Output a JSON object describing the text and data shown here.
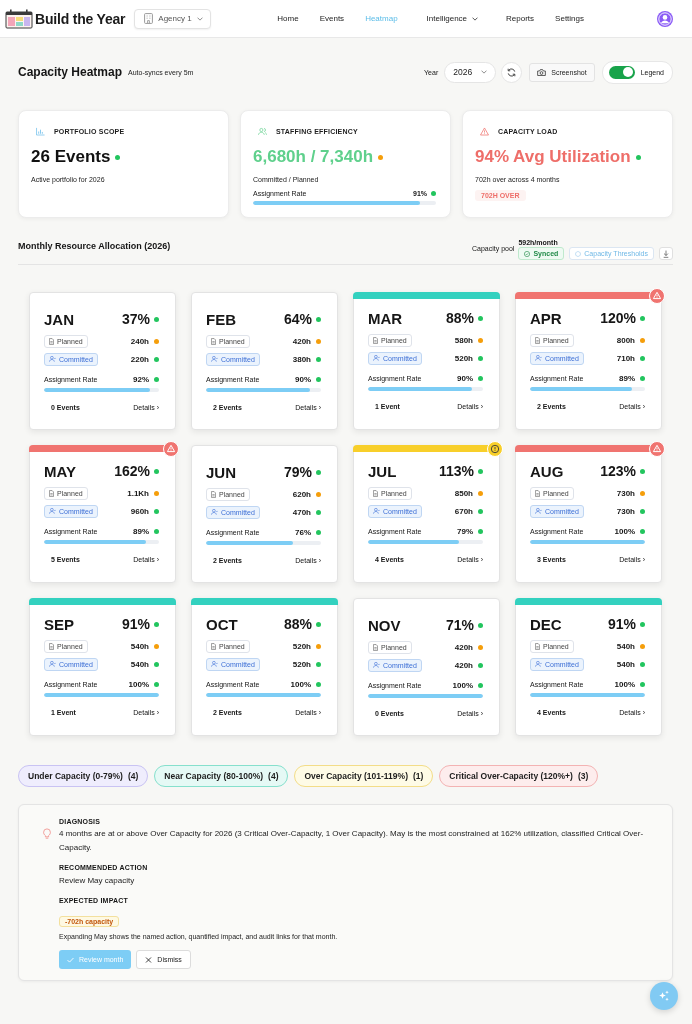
{
  "header": {
    "brand": "Build the Year",
    "agency": "Agency 1",
    "nav": [
      {
        "label": "Home",
        "selected": false,
        "dropdown": false
      },
      {
        "label": "Events",
        "selected": false,
        "dropdown": false
      },
      {
        "label": "Heatmap",
        "selected": true,
        "dropdown": false
      },
      {
        "label": "Intelligence",
        "selected": false,
        "dropdown": true
      },
      {
        "label": "Reports",
        "selected": false,
        "dropdown": false
      },
      {
        "label": "Settings",
        "selected": false,
        "dropdown": false
      }
    ]
  },
  "toolbar": {
    "title": "Capacity Heatmap",
    "subtitle": "Auto-syncs every 5m",
    "year_label": "Year",
    "year": "2026",
    "screenshot": "Screenshot",
    "legend": {
      "label": "Legend",
      "on": true
    }
  },
  "summary": [
    {
      "kind": "scope",
      "title": "PORTFOLIO SCOPE",
      "value": "26 Events",
      "color": "#22c55e",
      "note": "Active portfolio for 2026"
    },
    {
      "kind": "staffing",
      "title": "STAFFING EFFICIENCY",
      "value": "6,680h / 7,340h",
      "color": "#f59e0b",
      "note": "Committed / Planned",
      "rate_label": "Assignment Rate",
      "rate": "91%",
      "level": 0.91
    },
    {
      "kind": "load",
      "title": "CAPACITY LOAD",
      "value": "94% Avg Utilization",
      "color": "#22c55e",
      "note": "702h over across 4 months",
      "badge": "702H OVER"
    }
  ],
  "allocation": {
    "title": "Monthly Resource Allocation (2026)",
    "pool_label": "Capacity pool",
    "pool": "592h/month",
    "synced": "Synced",
    "thresholds": "Capacity Thresholds"
  },
  "months": [
    {
      "name": "JAN",
      "utilization": "37%",
      "kind": "under",
      "planned_label": "Planned",
      "planned": "240h",
      "committed_label": "Committed",
      "committed": "220h",
      "rate_label": "Assignment Rate",
      "rate": "92%",
      "level": 0.92,
      "events": "0 Events",
      "details": "Details ›"
    },
    {
      "name": "FEB",
      "utilization": "64%",
      "kind": "under",
      "planned_label": "Planned",
      "planned": "420h",
      "committed_label": "Committed",
      "committed": "380h",
      "rate_label": "Assignment Rate",
      "rate": "90%",
      "level": 0.9,
      "events": "2 Events",
      "details": "Details ›"
    },
    {
      "name": "MAR",
      "utilization": "88%",
      "kind": "near",
      "planned_label": "Planned",
      "planned": "580h",
      "committed_label": "Committed",
      "committed": "520h",
      "rate_label": "Assignment Rate",
      "rate": "90%",
      "level": 0.9,
      "events": "1 Event",
      "details": "Details ›"
    },
    {
      "name": "APR",
      "utilization": "120%",
      "kind": "critical",
      "planned_label": "Planned",
      "planned": "800h",
      "committed_label": "Committed",
      "committed": "710h",
      "rate_label": "Assignment Rate",
      "rate": "89%",
      "level": 0.89,
      "events": "2 Events",
      "details": "Details ›"
    },
    {
      "name": "MAY",
      "utilization": "162%",
      "kind": "critical",
      "planned_label": "Planned",
      "planned": "1.1Kh",
      "committed_label": "Committed",
      "committed": "960h",
      "rate_label": "Assignment Rate",
      "rate": "89%",
      "level": 0.89,
      "events": "5 Events",
      "details": "Details ›"
    },
    {
      "name": "JUN",
      "utilization": "79%",
      "kind": "under",
      "planned_label": "Planned",
      "planned": "620h",
      "committed_label": "Committed",
      "committed": "470h",
      "rate_label": "Assignment Rate",
      "rate": "76%",
      "level": 0.76,
      "events": "2 Events",
      "details": "Details ›"
    },
    {
      "name": "JUL",
      "utilization": "113%",
      "kind": "over",
      "planned_label": "Planned",
      "planned": "850h",
      "committed_label": "Committed",
      "committed": "670h",
      "rate_label": "Assignment Rate",
      "rate": "79%",
      "level": 0.79,
      "events": "4 Events",
      "details": "Details ›"
    },
    {
      "name": "AUG",
      "utilization": "123%",
      "kind": "critical",
      "planned_label": "Planned",
      "planned": "730h",
      "committed_label": "Committed",
      "committed": "730h",
      "rate_label": "Assignment Rate",
      "rate": "100%",
      "level": 1,
      "events": "3 Events",
      "details": "Details ›"
    },
    {
      "name": "SEP",
      "utilization": "91%",
      "kind": "near",
      "planned_label": "Planned",
      "planned": "540h",
      "committed_label": "Committed",
      "committed": "540h",
      "rate_label": "Assignment Rate",
      "rate": "100%",
      "level": 1,
      "events": "1 Event",
      "details": "Details ›"
    },
    {
      "name": "OCT",
      "utilization": "88%",
      "kind": "near",
      "planned_label": "Planned",
      "planned": "520h",
      "committed_label": "Committed",
      "committed": "520h",
      "rate_label": "Assignment Rate",
      "rate": "100%",
      "level": 1,
      "events": "2 Events",
      "details": "Details ›"
    },
    {
      "name": "NOV",
      "utilization": "71%",
      "kind": "under",
      "planned_label": "Planned",
      "planned": "420h",
      "committed_label": "Committed",
      "committed": "420h",
      "rate_label": "Assignment Rate",
      "rate": "100%",
      "level": 1,
      "events": "0 Events",
      "details": "Details ›"
    },
    {
      "name": "DEC",
      "utilization": "91%",
      "kind": "near",
      "planned_label": "Planned",
      "planned": "540h",
      "committed_label": "Committed",
      "committed": "540h",
      "rate_label": "Assignment Rate",
      "rate": "100%",
      "level": 1,
      "events": "4 Events",
      "details": "Details ›"
    }
  ],
  "legend": [
    {
      "kind": "under",
      "label": "Under Capacity (0-79%)",
      "count": "(4)"
    },
    {
      "kind": "near",
      "label": "Near Capacity (80-100%)",
      "count": "(4)"
    },
    {
      "kind": "over",
      "label": "Over Capacity (101-119%)",
      "count": "(1)"
    },
    {
      "kind": "critical",
      "label": "Critical Over-Capacity (120%+)",
      "count": "(3)"
    }
  ],
  "diagnosis": {
    "heading": "DIAGNOSIS",
    "text": "4 months are at or above Over Capacity for 2026 (3 Critical Over-Capacity, 1 Over Capacity). May is the most constrained at 162% utilization, classified Critical Over-Capacity.",
    "action_heading": "RECOMMENDED ACTION",
    "action": "Review May capacity",
    "impact_heading": "EXPECTED IMPACT",
    "impact": "-702h capacity",
    "note": "Expanding May shows the named action, quantified impact, and audit links for that month.",
    "buttons": [
      {
        "kind": "primary",
        "label": "Review month"
      },
      {
        "kind": "secondary",
        "label": "Dismiss"
      }
    ]
  }
}
